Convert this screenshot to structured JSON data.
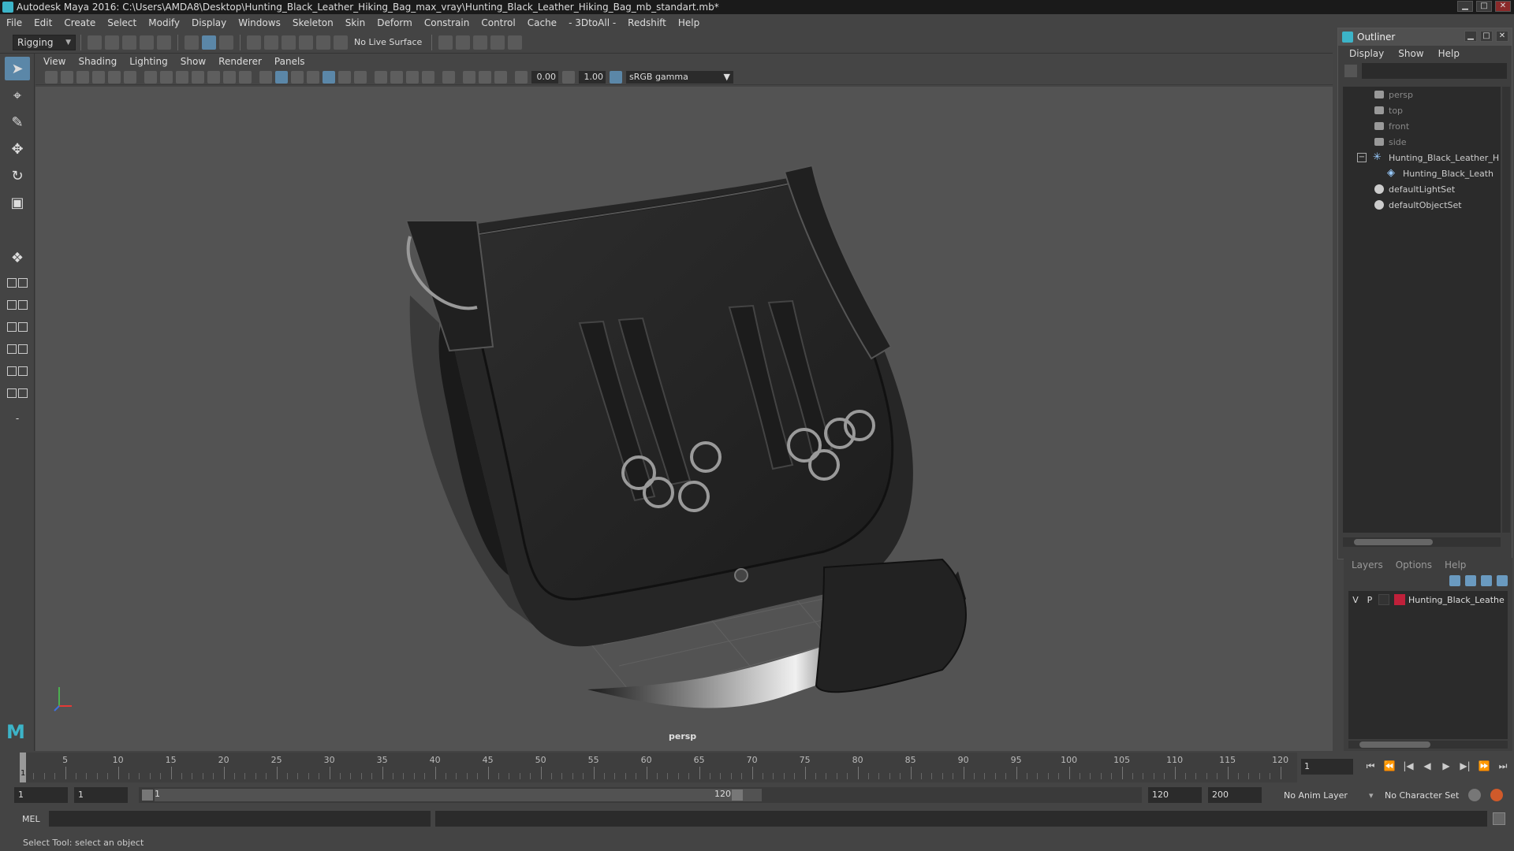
{
  "window": {
    "title": "Autodesk Maya 2016: C:\\Users\\AMDA8\\Desktop\\Hunting_Black_Leather_Hiking_Bag_max_vray\\Hunting_Black_Leather_Hiking_Bag_mb_standart.mb*",
    "minimize": "▁",
    "maximize": "□",
    "close": "✕"
  },
  "menubar": [
    "File",
    "Edit",
    "Create",
    "Select",
    "Modify",
    "Display",
    "Windows",
    "Skeleton",
    "Skin",
    "Deform",
    "Constrain",
    "Control",
    "Cache",
    "- 3DtoAll -",
    "Redshift",
    "Help"
  ],
  "shelf": {
    "mode": "Rigging",
    "live_surface": "No Live Surface"
  },
  "viewport": {
    "menu": [
      "View",
      "Shading",
      "Lighting",
      "Show",
      "Renderer",
      "Panels"
    ],
    "field_a": "0.00",
    "field_b": "1.00",
    "color_space": "sRGB gamma",
    "camera_label": "persp"
  },
  "outliner": {
    "title": "Outliner",
    "menu": [
      "Display",
      "Show",
      "Help"
    ],
    "items": [
      {
        "label": "persp",
        "type": "camera"
      },
      {
        "label": "top",
        "type": "camera"
      },
      {
        "label": "front",
        "type": "camera"
      },
      {
        "label": "side",
        "type": "camera"
      },
      {
        "label": "Hunting_Black_Leather_H",
        "type": "group",
        "expander": "−"
      },
      {
        "label": "Hunting_Black_Leath",
        "type": "mesh"
      },
      {
        "label": "defaultLightSet",
        "type": "set"
      },
      {
        "label": "defaultObjectSet",
        "type": "set"
      }
    ]
  },
  "layers": {
    "menu": [
      "Layers",
      "Options",
      "Help"
    ],
    "rows": [
      {
        "v": "V",
        "p": "P",
        "name": "Hunting_Black_Leathe",
        "color": "#c0203a"
      }
    ]
  },
  "timeline": {
    "ticks": [
      5,
      10,
      15,
      20,
      25,
      30,
      35,
      40,
      45,
      50,
      55,
      60,
      65,
      70,
      75,
      80,
      85,
      90,
      95,
      100,
      105,
      110,
      115,
      120
    ],
    "min": 1,
    "max": 120,
    "current_frame": 1,
    "current_field": "1"
  },
  "range": {
    "start": "1",
    "playback_start": "1",
    "slider_start": "1",
    "slider_end": "120",
    "playback_end": "120",
    "end": "200",
    "anim_layer": "No Anim Layer",
    "character_set": "No Character Set"
  },
  "cmdline": {
    "label": "MEL"
  },
  "helpline": {
    "text": "Select Tool: select an object"
  }
}
